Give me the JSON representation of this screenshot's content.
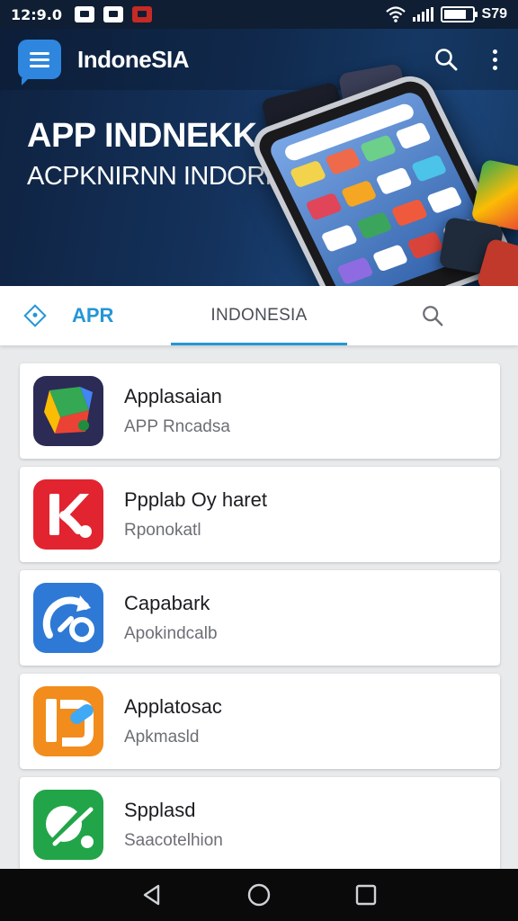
{
  "status_bar": {
    "time": "12:9.0",
    "battery_text": "S79",
    "icons": [
      "messenger-icon",
      "photo-icon",
      "gift-icon",
      "wifi-icon",
      "signal-icon",
      "battery-icon"
    ]
  },
  "app_bar": {
    "title": "IndoneSIA",
    "icons": [
      "menu-chat-icon",
      "search-icon",
      "more-vert-icon"
    ]
  },
  "hero": {
    "title": "APP INDNEKK",
    "subtitle": "ACPKNIRNN INDORNEKG"
  },
  "tabs": [
    {
      "label": "APR",
      "active": false,
      "icon": "diamond-icon"
    },
    {
      "label": "INDONESIA",
      "active": true
    },
    {
      "icon": "search-icon"
    }
  ],
  "apps": [
    {
      "name": "Applasaian",
      "subtitle": "APP Rncadsa"
    },
    {
      "name": "Ppplab Oy haret",
      "subtitle": "Rponokatl"
    },
    {
      "name": "Capabark",
      "subtitle": "Apokindcalb"
    },
    {
      "name": "Applatosac",
      "subtitle": "Apkmasld"
    },
    {
      "name": "Spplasd",
      "subtitle": "Saacotelhion"
    }
  ],
  "nav_bar": {
    "icons": [
      "back-icon",
      "home-icon",
      "recents-icon"
    ]
  },
  "colors": {
    "accent": "#2596d6",
    "hero_bg": "#14325c",
    "status_bar": "#0f1e33"
  }
}
